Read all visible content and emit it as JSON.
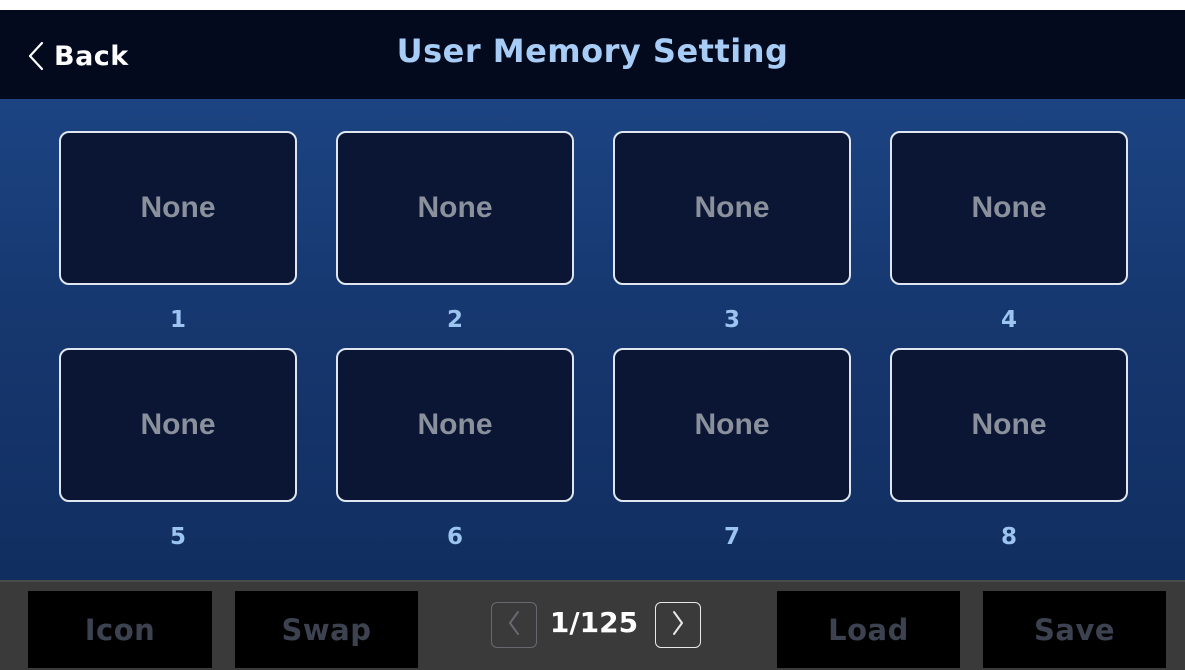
{
  "header": {
    "back_label": "Back",
    "title": "User Memory Setting"
  },
  "slots": [
    {
      "label": "None",
      "number": "1"
    },
    {
      "label": "None",
      "number": "2"
    },
    {
      "label": "None",
      "number": "3"
    },
    {
      "label": "None",
      "number": "4"
    },
    {
      "label": "None",
      "number": "5"
    },
    {
      "label": "None",
      "number": "6"
    },
    {
      "label": "None",
      "number": "7"
    },
    {
      "label": "None",
      "number": "8"
    }
  ],
  "footer": {
    "icon_label": "Icon",
    "swap_label": "Swap",
    "page_indicator": "1/125",
    "load_label": "Load",
    "save_label": "Save"
  },
  "icons": {
    "back": "chevron-left-icon",
    "prev_page": "chevron-left-icon",
    "next_page": "chevron-right-icon"
  },
  "colors": {
    "header_bg": "#040a1d",
    "title": "#a7ccf5",
    "grid_bg": "#16376f",
    "slot_bg": "#0a1633",
    "slot_border": "#dfe6f0",
    "slot_text": "#8a909c",
    "slot_number": "#9cc4f0",
    "bottom_bar_bg": "#3a3a3a",
    "disabled_button_text": "#3c4250"
  }
}
